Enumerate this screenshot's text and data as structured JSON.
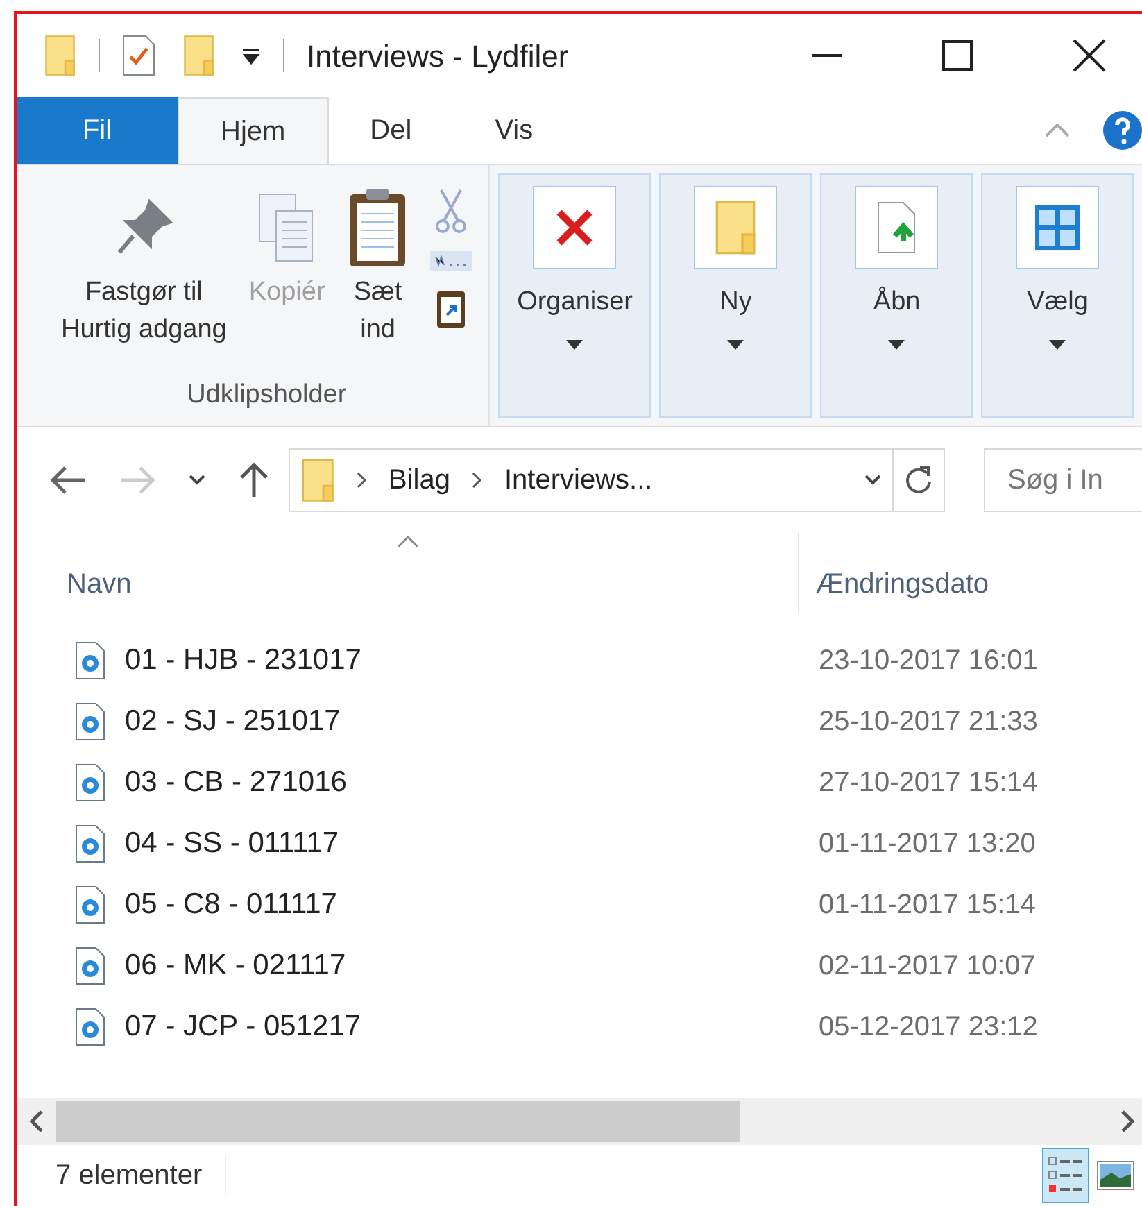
{
  "window": {
    "title": "Interviews - Lydfiler"
  },
  "tabs": [
    {
      "label": "Fil",
      "kind": "file",
      "selected": false
    },
    {
      "label": "Hjem",
      "kind": "tab",
      "selected": true
    },
    {
      "label": "Del",
      "kind": "tab",
      "selected": false
    },
    {
      "label": "Vis",
      "kind": "tab",
      "selected": false
    }
  ],
  "ribbon": {
    "clipboard_group": {
      "label": "Udklipsholder",
      "buttons": [
        {
          "lines": [
            "Fastgør til",
            "Hurtig adgang"
          ],
          "kind": "pin",
          "disabled": false
        },
        {
          "lines": [
            "Kopiér"
          ],
          "kind": "copy",
          "disabled": true
        },
        {
          "lines": [
            "Sæt",
            "ind"
          ],
          "kind": "paste",
          "disabled": false
        }
      ]
    },
    "collapsed_groups": [
      {
        "label": "Organiser",
        "kind": "delete"
      },
      {
        "label": "Ny",
        "kind": "folder"
      },
      {
        "label": "Åbn",
        "kind": "open"
      },
      {
        "label": "Vælg",
        "kind": "select"
      }
    ]
  },
  "address_bar": {
    "breadcrumbs": [
      "Bilag",
      "Interviews..."
    ]
  },
  "search": {
    "placeholder": "Søg i In"
  },
  "columns": [
    {
      "label": "Navn",
      "sorted": true
    },
    {
      "label": "Ændringsdato",
      "sorted": false
    }
  ],
  "rows": [
    {
      "name": "01 - HJB - 231017",
      "date": "23-10-2017 16:01"
    },
    {
      "name": "02 - SJ - 251017",
      "date": "25-10-2017 21:33"
    },
    {
      "name": "03 - CB - 271016",
      "date": "27-10-2017 15:14"
    },
    {
      "name": "04 - SS - 011117",
      "date": "01-11-2017 13:20"
    },
    {
      "name": "05 - C8 - 011117",
      "date": "01-11-2017 15:14"
    },
    {
      "name": "06 - MK - 021117",
      "date": "02-11-2017 10:07"
    },
    {
      "name": "07 - JCP - 051217",
      "date": "05-12-2017 23:12"
    }
  ],
  "status_bar": {
    "count": "7 elementer"
  },
  "views": [
    {
      "kind": "details",
      "selected": true
    },
    {
      "kind": "large_icons",
      "selected": false
    }
  ]
}
